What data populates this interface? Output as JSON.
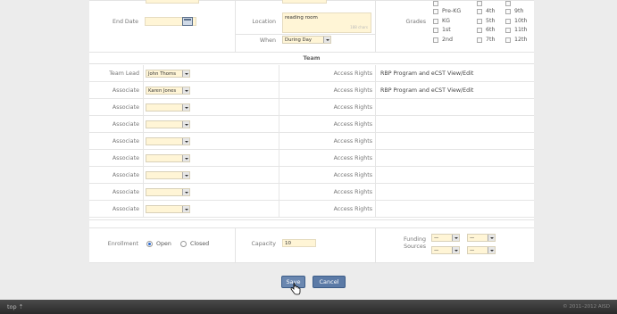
{
  "event": {
    "end_date_label": "End Date",
    "end_date_value": "",
    "location_label": "Location",
    "location_value": "reading room",
    "location_counter": "188 chars",
    "when_label": "When",
    "when_value": "During Day",
    "grades_label": "Grades",
    "grades": [
      {
        "label": "Pre-KG",
        "checked": false
      },
      {
        "label": "KG",
        "checked": false
      },
      {
        "label": "1st",
        "checked": false
      },
      {
        "label": "2nd",
        "checked": false
      },
      {
        "label": "4th",
        "checked": false
      },
      {
        "label": "5th",
        "checked": false
      },
      {
        "label": "6th",
        "checked": false
      },
      {
        "label": "7th",
        "checked": false
      },
      {
        "label": "9th",
        "checked": false
      },
      {
        "label": "10th",
        "checked": false
      },
      {
        "label": "11th",
        "checked": false
      },
      {
        "label": "12th",
        "checked": false
      }
    ]
  },
  "team": {
    "header": "Team",
    "rows": [
      {
        "role": "Team Lead",
        "member": "John Thoms",
        "access_label": "Access Rights",
        "access_value": "RBP Program and eCST View/Edit"
      },
      {
        "role": "Associate",
        "member": "Karen Jones",
        "access_label": "Access Rights",
        "access_value": "RBP Program and eCST View/Edit"
      },
      {
        "role": "Associate",
        "member": "",
        "access_label": "Access Rights",
        "access_value": ""
      },
      {
        "role": "Associate",
        "member": "",
        "access_label": "Access Rights",
        "access_value": ""
      },
      {
        "role": "Associate",
        "member": "",
        "access_label": "Access Rights",
        "access_value": ""
      },
      {
        "role": "Associate",
        "member": "",
        "access_label": "Access Rights",
        "access_value": ""
      },
      {
        "role": "Associate",
        "member": "",
        "access_label": "Access Rights",
        "access_value": ""
      },
      {
        "role": "Associate",
        "member": "",
        "access_label": "Access Rights",
        "access_value": ""
      },
      {
        "role": "Associate",
        "member": "",
        "access_label": "Access Rights",
        "access_value": ""
      }
    ]
  },
  "enrollment": {
    "label": "Enrollment",
    "open_label": "Open",
    "closed_label": "Closed",
    "selected": "Open",
    "capacity_label": "Capacity",
    "capacity_value": "10",
    "funding_label_1": "Funding",
    "funding_label_2": "Sources",
    "funding_options": [
      "—",
      "—",
      "—",
      "—"
    ]
  },
  "actions": {
    "save_label": "Save",
    "cancel_label": "Cancel"
  },
  "footer": {
    "top_label": "top",
    "copyright": "© 2011–2012 AISD"
  },
  "colors": {
    "input_bg": "#fff5d6",
    "button_bg": "#5b7aa6",
    "footer_bg": "#333333"
  }
}
